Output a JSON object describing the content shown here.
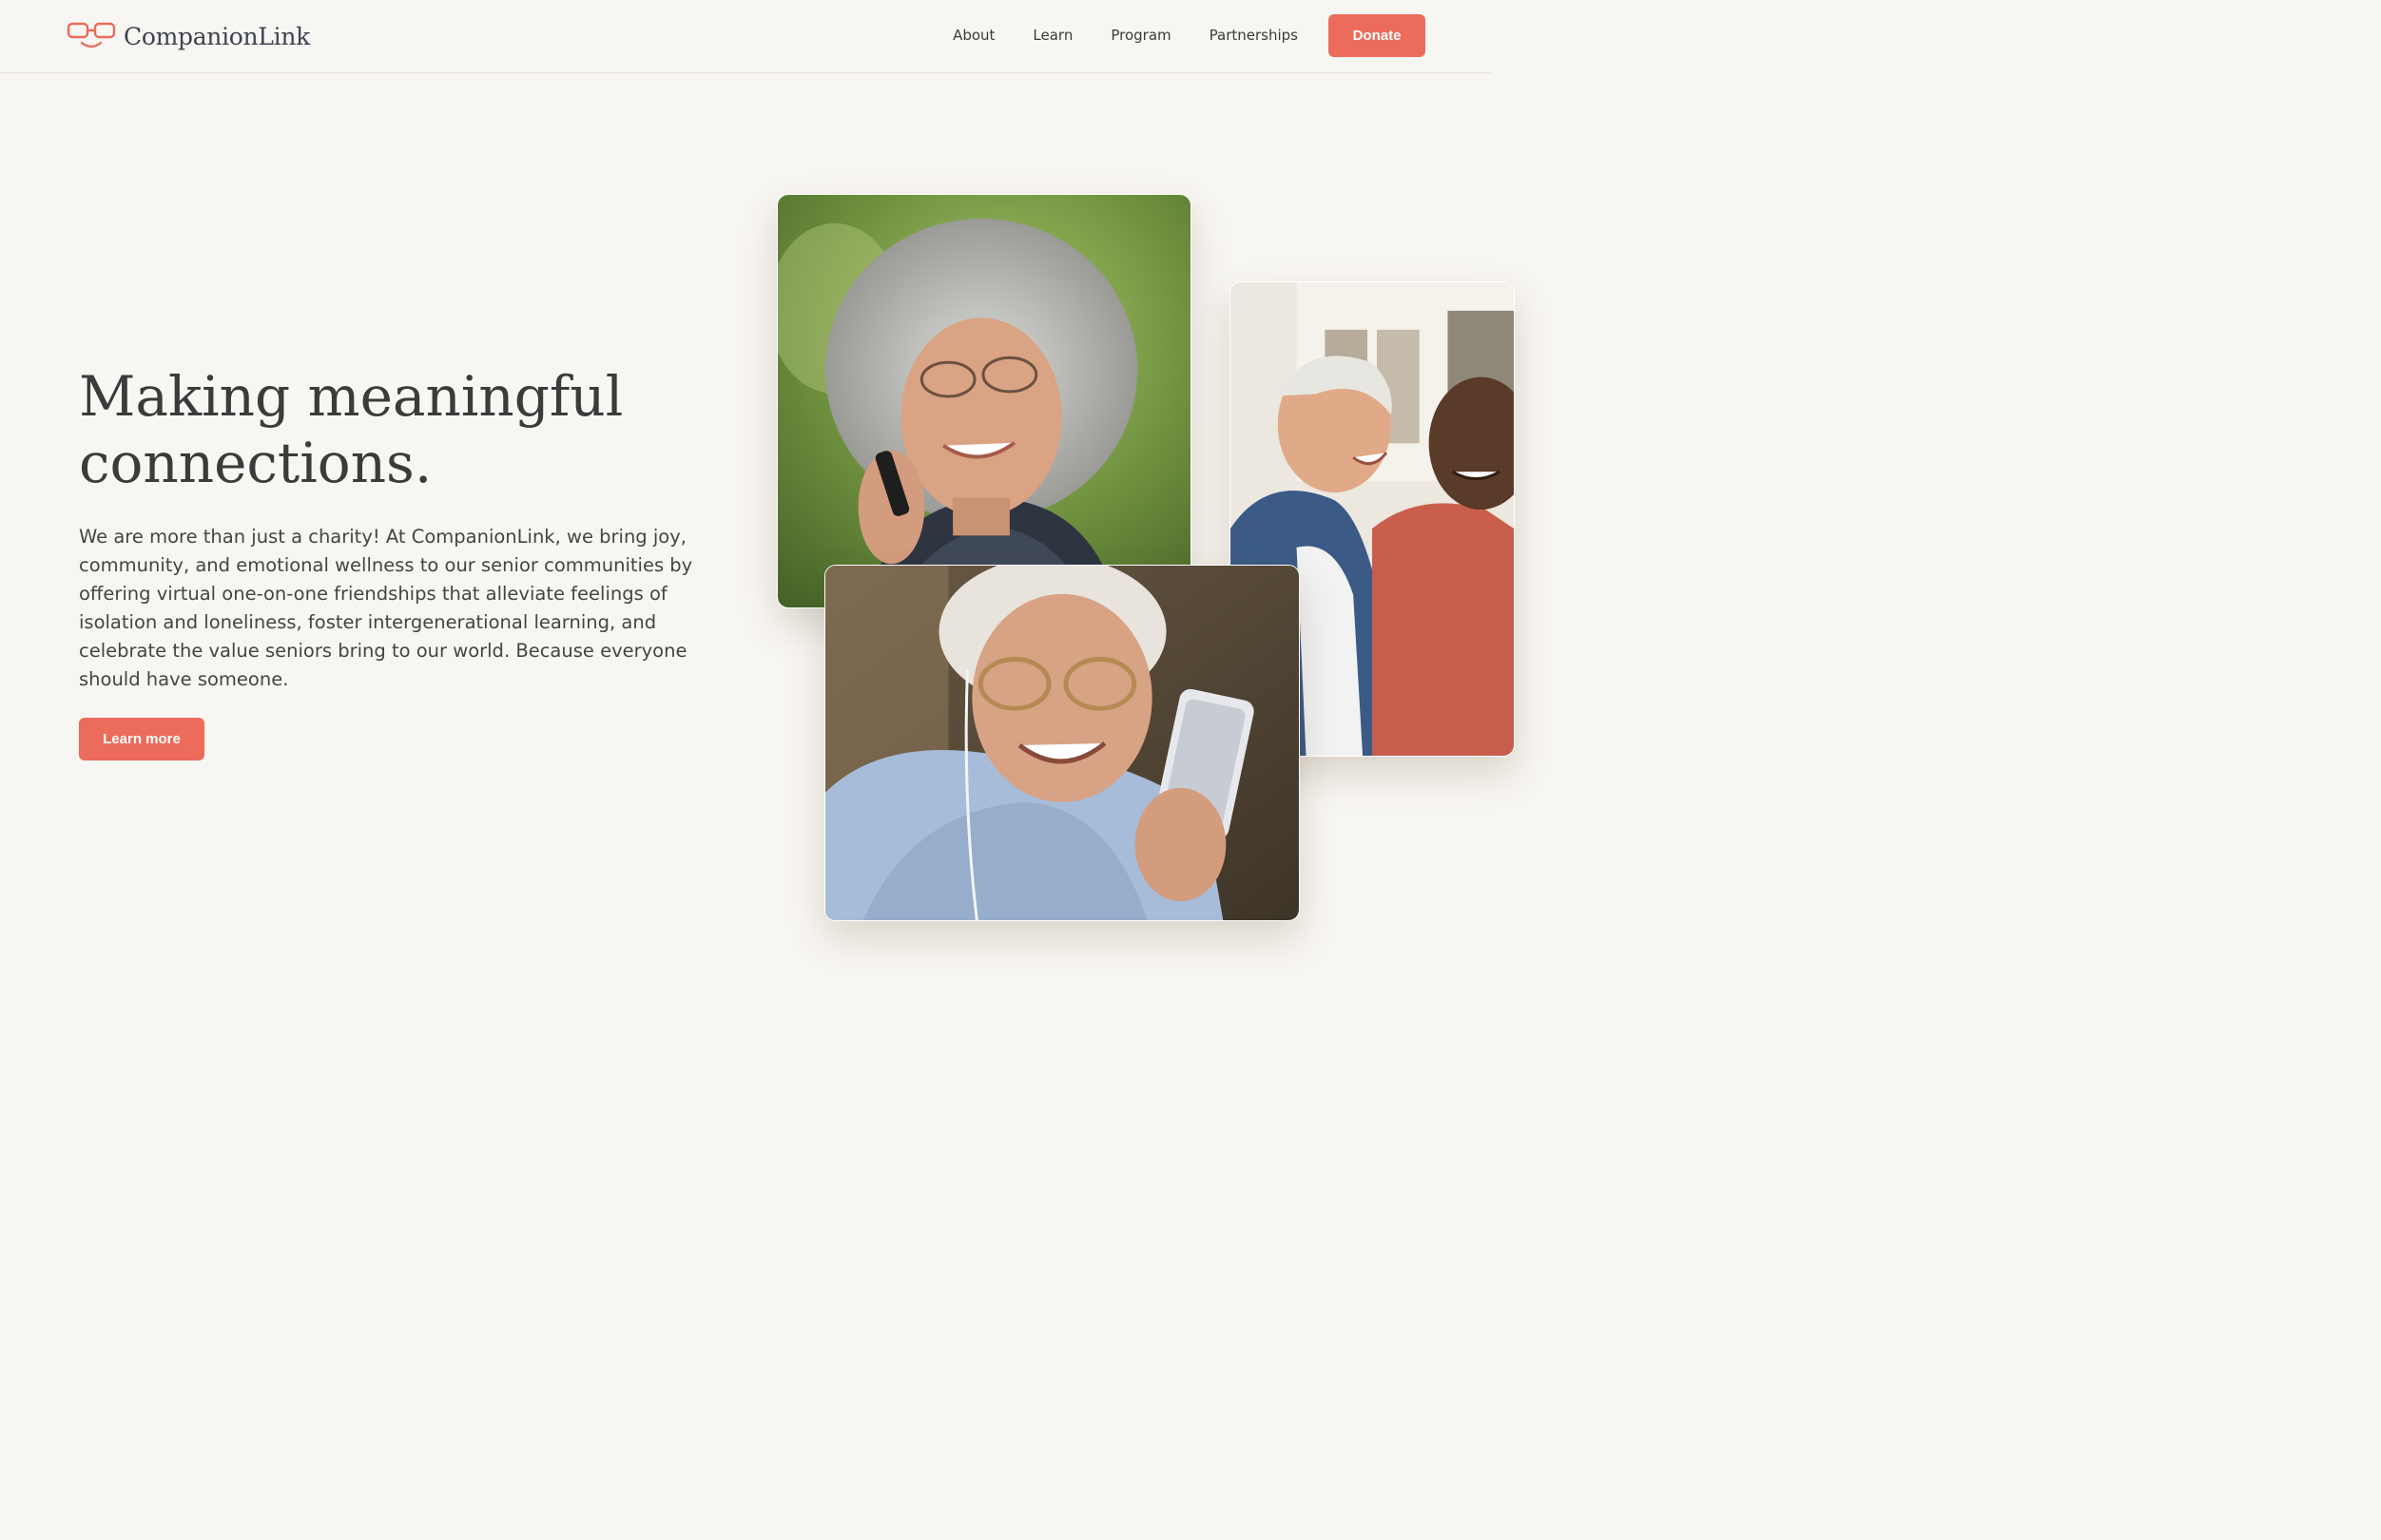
{
  "header": {
    "brand": {
      "name": "CompanionLink",
      "logo_icon": "linked-glasses-smile-icon",
      "logo_color": "#ec6b5b"
    },
    "nav": [
      {
        "label": "About"
      },
      {
        "label": "Learn"
      },
      {
        "label": "Program"
      },
      {
        "label": "Partnerships"
      }
    ],
    "donate_label": "Donate"
  },
  "hero": {
    "title_line1": "Making meaningful",
    "title_line2": "connections.",
    "body": "We are more than just a charity! At CompanionLink, we bring joy, community, and emotional wellness to our senior communities by offering virtual one-on-one friendships that alleviate feelings of isolation and loneliness, foster intergenerational learning, and celebrate the value seniors bring to our world. Because everyone should have someone.",
    "cta_label": "Learn more"
  },
  "photos": [
    {
      "subject": "senior-woman-on-phone-photo"
    },
    {
      "subject": "two-senior-men-laughing-photo"
    },
    {
      "subject": "senior-woman-video-call-photo"
    }
  ],
  "colors": {
    "accent": "#ec6b5b",
    "background": "#f8f6f2",
    "text": "#3b3b3b"
  }
}
